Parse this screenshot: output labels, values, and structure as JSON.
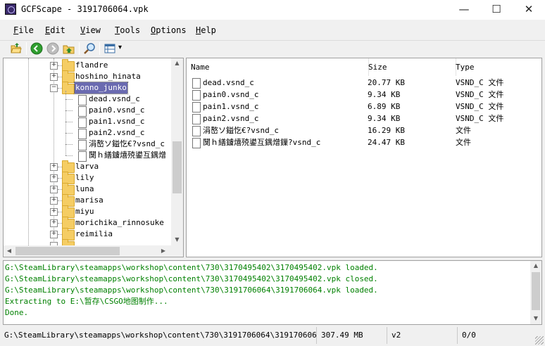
{
  "window": {
    "title": "GCFScape - 3191706064.vpk",
    "minimize": "—",
    "maximize": "☐",
    "close": "✕"
  },
  "menu": [
    {
      "key": "F",
      "rest": "ile"
    },
    {
      "key": "E",
      "rest": "dit"
    },
    {
      "key": "V",
      "rest": "iew"
    },
    {
      "key": "T",
      "rest": "ools"
    },
    {
      "key": "O",
      "rest": "ptions"
    },
    {
      "key": "H",
      "rest": "elp"
    }
  ],
  "toolbar": {
    "view_icon": "view-grid-icon",
    "dropdown": "▾"
  },
  "tree": {
    "folders_top": [
      "flandre",
      "hoshino_hinata"
    ],
    "selected": "konno_junko",
    "files": [
      "dead.vsnd_c",
      "pain0.vsnd_c",
      "pain1.vsnd_c",
      "pain2.vsnd_c",
      "涓嶅ソ鎰忔€?vsnd_c",
      "闅ｈ繕鐪熺殑鍙互鍝熷"
    ],
    "folders_bottom": [
      "larva",
      "lily",
      "luna",
      "marisa",
      "miyu",
      "morichika_rinnosuke",
      "reimilia"
    ],
    "expand_plus": "+",
    "expand_minus": "−"
  },
  "list": {
    "columns": {
      "name": "Name",
      "size": "Size",
      "type": "Type"
    },
    "rows": [
      {
        "name": "dead.vsnd_c",
        "size": "20.77 KB",
        "type": "VSND_C 文件"
      },
      {
        "name": "pain0.vsnd_c",
        "size": "9.34 KB",
        "type": "VSND_C 文件"
      },
      {
        "name": "pain1.vsnd_c",
        "size": "6.89 KB",
        "type": "VSND_C 文件"
      },
      {
        "name": "pain2.vsnd_c",
        "size": "9.34 KB",
        "type": "VSND_C 文件"
      },
      {
        "name": "涓嶅ソ鎰忔€?vsnd_c",
        "size": "16.29 KB",
        "type": "文件"
      },
      {
        "name": "闅ｈ繕鐪熺殑鍙互鍝熷鏁?vsnd_c",
        "size": "24.47 KB",
        "type": "文件"
      }
    ]
  },
  "log": [
    "G:\\SteamLibrary\\steamapps\\workshop\\content\\730\\3170495402\\3170495402.vpk loaded.",
    "G:\\SteamLibrary\\steamapps\\workshop\\content\\730\\3170495402\\3170495402.vpk closed.",
    "G:\\SteamLibrary\\steamapps\\workshop\\content\\730\\3191706064\\3191706064.vpk loaded.",
    "Extracting to E:\\暂存\\CSGO地图制作...",
    "Done."
  ],
  "status": {
    "path": "G:\\SteamLibrary\\steamapps\\workshop\\content\\730\\3191706064\\3191706064.vpk",
    "size": "307.49 MB",
    "version": "v2",
    "fragmentation": "0/0"
  },
  "colors": {
    "accent_selection": "#6a6ab0",
    "log_text": "#008000",
    "folder": "#f5cd64"
  }
}
